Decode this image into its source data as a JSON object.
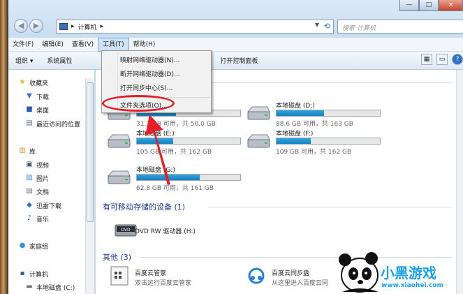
{
  "window": {
    "address_path": "计算机",
    "search_placeholder": "搜索 计算机",
    "min_symbol": "—",
    "max_symbol": "□",
    "close_symbol": "×"
  },
  "menubar": [
    "文件(F)",
    "编辑(E)",
    "查看(V)",
    "工具(T)",
    "帮助(H)"
  ],
  "toolbar": {
    "organize": "组织 ▾",
    "system_properties": "系统属性",
    "control_panel": "打开控制面板"
  },
  "nav": {
    "favorites": "收藏夹",
    "downloads": "下载",
    "desktop": "桌面",
    "recent": "最近访问的位置",
    "library": "库",
    "videos": "视频",
    "pictures": "图片",
    "documents": "文档",
    "xunlei": "迅雷下载",
    "music": "音乐",
    "homegroup": "家庭组",
    "computer": "计算机",
    "local_c": "本地磁盘 (C:)"
  },
  "tools_menu": {
    "map_drive": "映射网络驱动器(N)...",
    "disconnect_drive": "断开网络驱动器(D)...",
    "sync_center": "打开同步中心(S)...",
    "folder_options": "文件夹选项(O)..."
  },
  "drives": [
    {
      "name": "",
      "free": "31.1 GB 可用，共 50.0 GB",
      "used_fraction": 0.38
    },
    {
      "name": "本地磁盘 (D:)",
      "free": "88.6 GB 可用，共 163 GB",
      "used_fraction": 0.46
    },
    {
      "name": "本地磁盘 (E:)",
      "free": "105 GB 可用，共 162 GB",
      "used_fraction": 0.35
    },
    {
      "name": "本地磁盘 (F:)",
      "free": "109 GB 可用，共 162 GB",
      "used_fraction": 0.33
    },
    {
      "name": "本地磁盘 (G:)",
      "free": "62.8 GB 可用，共 161 GB",
      "used_fraction": 0.61
    }
  ],
  "removable_header": "有可移动存储的设备 (1)",
  "dvd_drive": "DVD RW 驱动器 (H:)",
  "dvd_logo": "DVD",
  "other_header": "其他 (3)",
  "other_items": [
    {
      "name": "百度云管家",
      "desc": "双击运行百度云管家"
    },
    {
      "name": "百度云同步盘",
      "desc": "从这里进入百度云同"
    }
  ],
  "watermark": {
    "brand": "小黑游戏",
    "url": "www.xiaohei.com"
  },
  "colors": {
    "usage_bar": "#1780be",
    "annotation": "#e3202a",
    "section_header": "#1e3a8a"
  }
}
